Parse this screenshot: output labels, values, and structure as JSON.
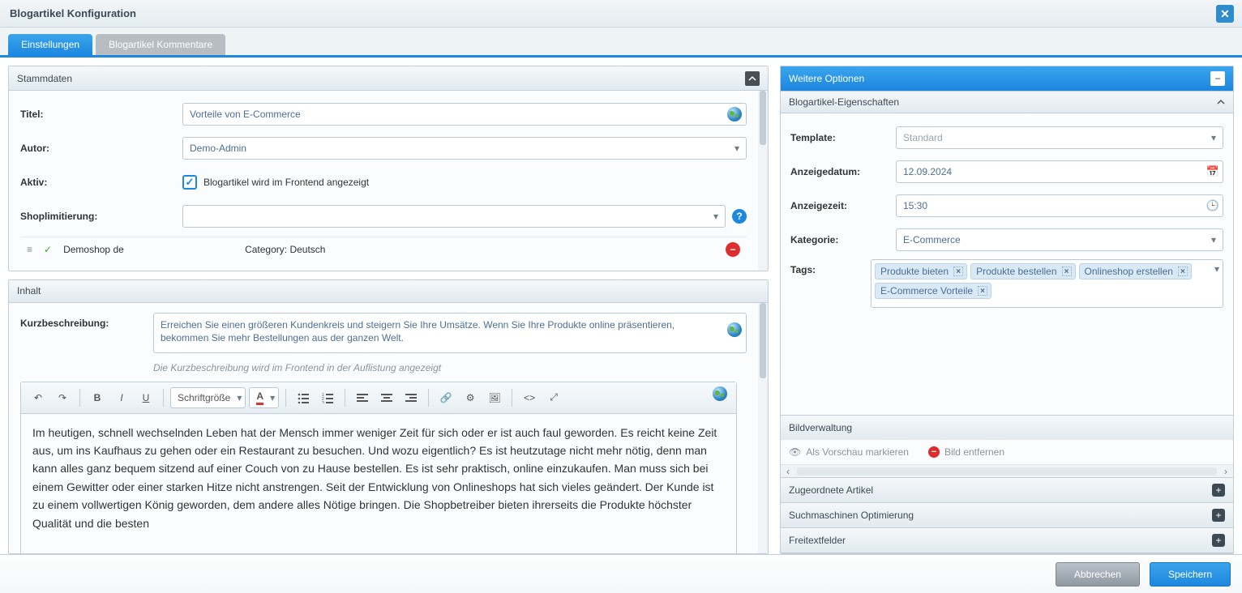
{
  "window": {
    "title": "Blogartikel Konfiguration"
  },
  "tabs": [
    {
      "label": "Einstellungen",
      "active": true
    },
    {
      "label": "Blogartikel Kommentare",
      "active": false
    }
  ],
  "stammdaten": {
    "header": "Stammdaten",
    "title_label": "Titel:",
    "title_value": "Vorteile von E-Commerce",
    "author_label": "Autor:",
    "author_value": "Demo-Admin",
    "active_label": "Aktiv:",
    "active_checked": true,
    "active_hint": "Blogartikel wird im Frontend angezeigt",
    "shoplimit_label": "Shoplimitierung:",
    "shoplimit_value": "",
    "shop_row": {
      "name": "Demoshop de",
      "category": "Category: Deutsch"
    }
  },
  "inhalt": {
    "header": "Inhalt",
    "short_label": "Kurzbeschreibung:",
    "short_value": "Erreichen Sie einen größeren Kundenkreis und steigern Sie Ihre Umsätze. Wenn Sie Ihre Produkte online präsentieren, bekommen Sie mehr Bestellungen aus der ganzen Welt.",
    "short_hint": "Die Kurzbeschreibung wird im Frontend in der Auflistung angezeigt",
    "toolbar": {
      "fontsize_label": "Schriftgröße"
    },
    "body_text": "Im heutigen, schnell wechselnden Leben hat der Mensch immer weniger Zeit für sich oder er ist auch faul geworden. Es reicht keine Zeit aus, um ins Kaufhaus zu gehen oder ein Restaurant zu besuchen. Und wozu eigentlich? Es ist heutzutage nicht mehr nötig, denn man kann alles ganz bequem sitzend auf einer Couch von zu Hause bestellen. Es ist sehr praktisch, online einzukaufen. Man muss sich bei einem Gewitter oder einer starken Hitze nicht anstrengen. Seit der Entwicklung von Onlineshops hat sich vieles geändert. Der Kunde ist zu einem vollwertigen König geworden, dem andere alles Nötige bringen. Die Shopbetreiber bieten ihrerseits die Produkte höchster Qualität und die besten"
  },
  "right": {
    "header": "Weitere Optionen",
    "properties": {
      "section": "Blogartikel-Eigenschaften",
      "template_label": "Template:",
      "template_value": "Standard",
      "date_label": "Anzeigedatum:",
      "date_value": "12.09.2024",
      "time_label": "Anzeigezeit:",
      "time_value": "15:30",
      "category_label": "Kategorie:",
      "category_value": "E-Commerce",
      "tags_label": "Tags:",
      "tags": [
        "Produkte bieten",
        "Produkte bestellen",
        "Onlineshop erstellen",
        "E-Commerce Vorteile"
      ]
    },
    "images": {
      "section": "Bildverwaltung",
      "mark_preview": "Als Vorschau markieren",
      "remove_image": "Bild entfernen"
    },
    "assigned_section": "Zugeordnete Artikel",
    "seo_section": "Suchmaschinen Optimierung",
    "freetext_section": "Freitextfelder"
  },
  "footer": {
    "cancel": "Abbrechen",
    "save": "Speichern"
  }
}
